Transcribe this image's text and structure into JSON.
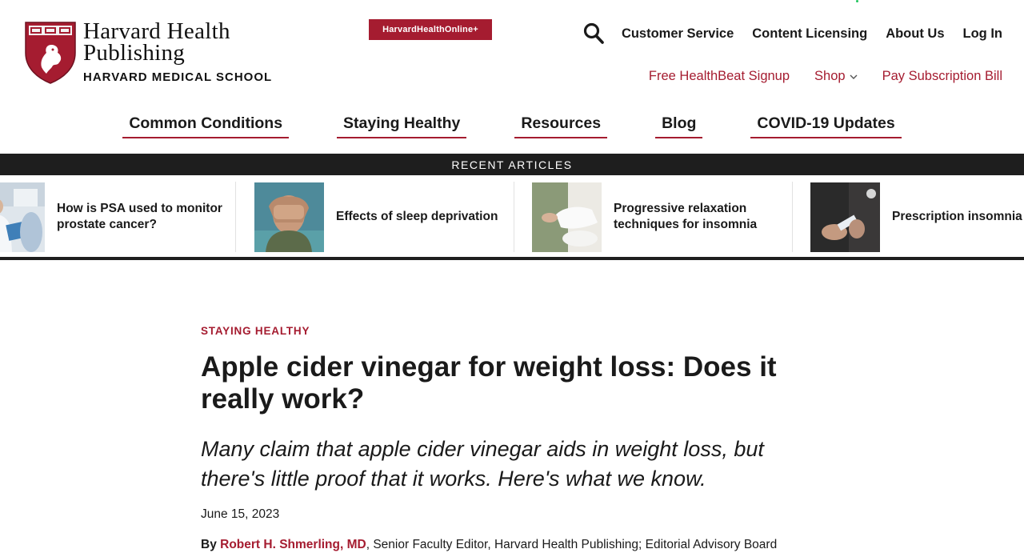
{
  "brand": {
    "line1": "Harvard Health",
    "line2": "Publishing",
    "line3": "HARVARD MEDICAL SCHOOL",
    "accent": "#a51c30"
  },
  "badge": {
    "label": "HarvardHealthOnline+"
  },
  "top_links": [
    "Customer Service",
    "Content Licensing",
    "About Us",
    "Log In"
  ],
  "sub_links": {
    "signup": "Free HealthBeat Signup",
    "shop": "Shop",
    "pay": "Pay Subscription Bill"
  },
  "main_nav": [
    "Common Conditions",
    "Staying Healthy",
    "Resources",
    "Blog",
    "COVID-19 Updates"
  ],
  "recent": {
    "heading": "RECENT ARTICLES",
    "items": [
      {
        "title": "How is PSA used to monitor prostate cancer?"
      },
      {
        "title": "Effects of sleep deprivation"
      },
      {
        "title": "Progressive relaxation techniques for insomnia"
      },
      {
        "title": "Prescription insomnia medications: What to know"
      }
    ]
  },
  "article": {
    "kicker": "STAYING HEALTHY",
    "headline": "Apple cider vinegar for weight loss: Does it really work?",
    "dek": "Many claim that apple cider vinegar aids in weight loss, but there's little proof that it works. Here's what we know.",
    "date": "June 15, 2023",
    "by": "By",
    "author": "Robert H. Shmerling, MD",
    "author_role": ", Senior Faculty Editor, Harvard Health Publishing; Editorial Advisory Board"
  }
}
